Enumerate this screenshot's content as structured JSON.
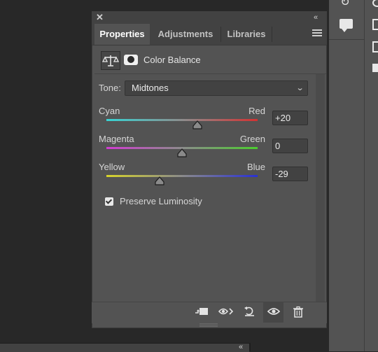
{
  "panel": {
    "tabs": [
      "Properties",
      "Adjustments",
      "Libraries"
    ],
    "active_tab": "Properties",
    "adjustment_title": "Color Balance"
  },
  "tone": {
    "label": "Tone:",
    "value": "Midtones"
  },
  "sliders": [
    {
      "left_label": "Cyan",
      "right_label": "Red",
      "value": "+20",
      "fraction": 0.6
    },
    {
      "left_label": "Magenta",
      "right_label": "Green",
      "value": "0",
      "fraction": 0.5
    },
    {
      "left_label": "Yellow",
      "right_label": "Blue",
      "value": "-29",
      "fraction": 0.35
    }
  ],
  "preserve_luminosity": {
    "label": "Preserve Luminosity",
    "checked": true
  },
  "colors": {
    "panel_bg": "#535353",
    "tab_bar_bg": "#424242",
    "canvas_bg": "#282828"
  }
}
